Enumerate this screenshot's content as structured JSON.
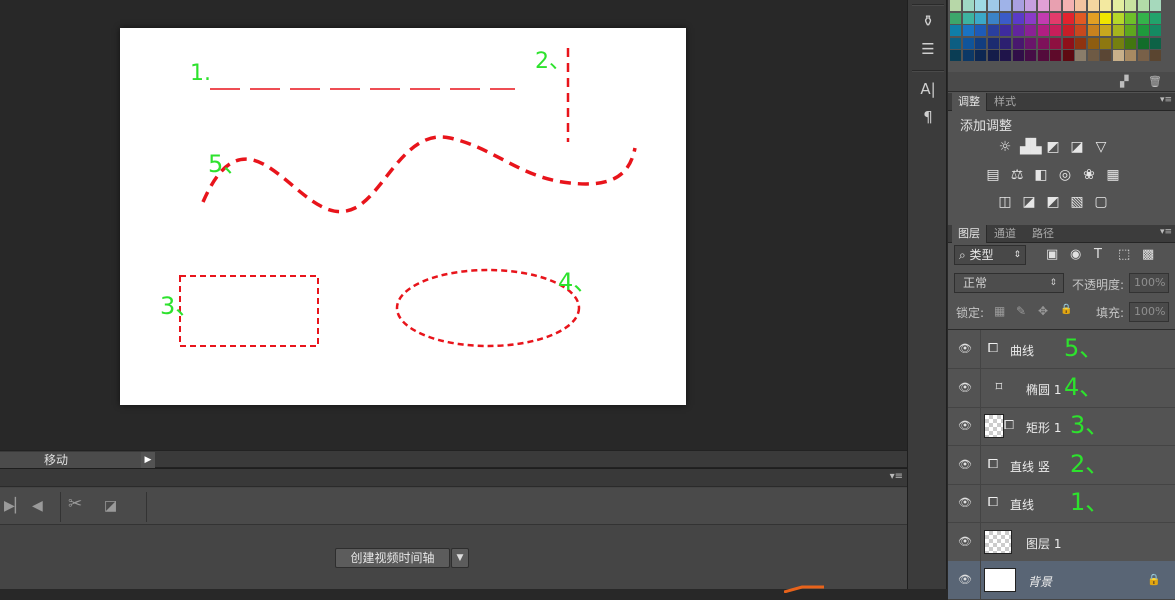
{
  "swatches": {
    "rows": [
      [
        "#b7d7a8",
        "#9fd8c4",
        "#9fd9e4",
        "#9fc9e8",
        "#9fb3e8",
        "#a9a0e0",
        "#c7a0e0",
        "#e0a0d6",
        "#e8a0b0",
        "#f3b2b2",
        "#f3c4a0",
        "#f3d6a0",
        "#f3e9a0",
        "#e4eea0",
        "#c9e3a0",
        "#b2dca8",
        "#a6d9bc"
      ],
      [
        "#3da66b",
        "#3db3a0",
        "#3ba8c8",
        "#3b83c8",
        "#3b5bc8",
        "#5a3bc8",
        "#8a3bc8",
        "#c23bb0",
        "#e23b6b",
        "#e2232e",
        "#e25a23",
        "#e2a023",
        "#f0e500",
        "#b6d72a",
        "#6ebf2a",
        "#34b34a",
        "#22a36b"
      ],
      [
        "#0f7ea8",
        "#1a73c2",
        "#1e5bb8",
        "#2a3f9e",
        "#3e2b9e",
        "#62259e",
        "#8a2195",
        "#b01e82",
        "#c81e5a",
        "#c81e28",
        "#c8481e",
        "#c8821e",
        "#c8a81e",
        "#a6b41e",
        "#5ea71e",
        "#1e9a3c",
        "#158a62"
      ],
      [
        "#0c5e82",
        "#10549a",
        "#123d80",
        "#1c2b70",
        "#2c1f70",
        "#48186e",
        "#6a156a",
        "#7e115a",
        "#8e1040",
        "#8e101a",
        "#8e3310",
        "#8e5d10",
        "#8e7810",
        "#758010",
        "#427610",
        "#126d2a",
        "#0d6246"
      ],
      [
        "#0a3d54",
        "#0c3866",
        "#0d2752",
        "#141d4a",
        "#1f144a",
        "#300f48",
        "#460d46",
        "#540b3c",
        "#5e0a2a",
        "#5e0a12",
        "#8a7d6a",
        "#6e5a44",
        "#5a4634",
        "#c8b08a",
        "#a88a62",
        "#786048",
        "#5a4530"
      ]
    ],
    "footer_icons": [
      "new-swatch-icon",
      "delete-swatch-icon"
    ]
  },
  "adjustments": {
    "tabs": [
      "调整",
      "样式"
    ],
    "title": "添加调整",
    "icons_row1": [
      "☼",
      "▟▙",
      "◩",
      "◪",
      "▽"
    ],
    "icons_row2": [
      "▤",
      "⚖",
      "◧",
      "◎",
      "❀",
      "▦"
    ],
    "icons_row3": [
      "◫",
      "◪",
      "◩",
      "▧",
      "▢"
    ]
  },
  "layers": {
    "tabs": [
      "图层",
      "通道",
      "路径"
    ],
    "filter": "⌕ 类型",
    "filter_icons": [
      "▣",
      "◉",
      "T",
      "⬚",
      "▩"
    ],
    "blend_mode": "正常",
    "opacity_label": "不透明度:",
    "opacity_value": "100%",
    "lock_label": "锁定:",
    "lock_icons": [
      "▦",
      "✎",
      "✥",
      "🔒"
    ],
    "fill_label": "填充:",
    "fill_value": "100%",
    "items": [
      {
        "name": "曲线",
        "thumb": "shape",
        "annotation": "5、"
      },
      {
        "name": "椭圆 1",
        "thumb": "shape-only",
        "annotation": "4、"
      },
      {
        "name": "矩形 1",
        "thumb": "checker-shape",
        "annotation": "3、"
      },
      {
        "name": "直线 竖",
        "thumb": "shape",
        "annotation": "2、"
      },
      {
        "name": "直线",
        "thumb": "shape",
        "annotation": "1、"
      },
      {
        "name": "图层 1",
        "thumb": "checker",
        "annotation": ""
      },
      {
        "name": "背景",
        "thumb": "white",
        "annotation": ""
      }
    ]
  },
  "status": {
    "tool_name": "移动"
  },
  "timeline": {
    "create_button": "创建视频时间轴"
  },
  "canvas_annotations": {
    "line1": "1.",
    "line2": "2、",
    "curve": "5、",
    "rect": "3、",
    "ellipse": "4、"
  },
  "colors": {
    "stroke_red": "#e8141b",
    "annotation_green": "#2de22d",
    "selected_row": "#596575"
  }
}
